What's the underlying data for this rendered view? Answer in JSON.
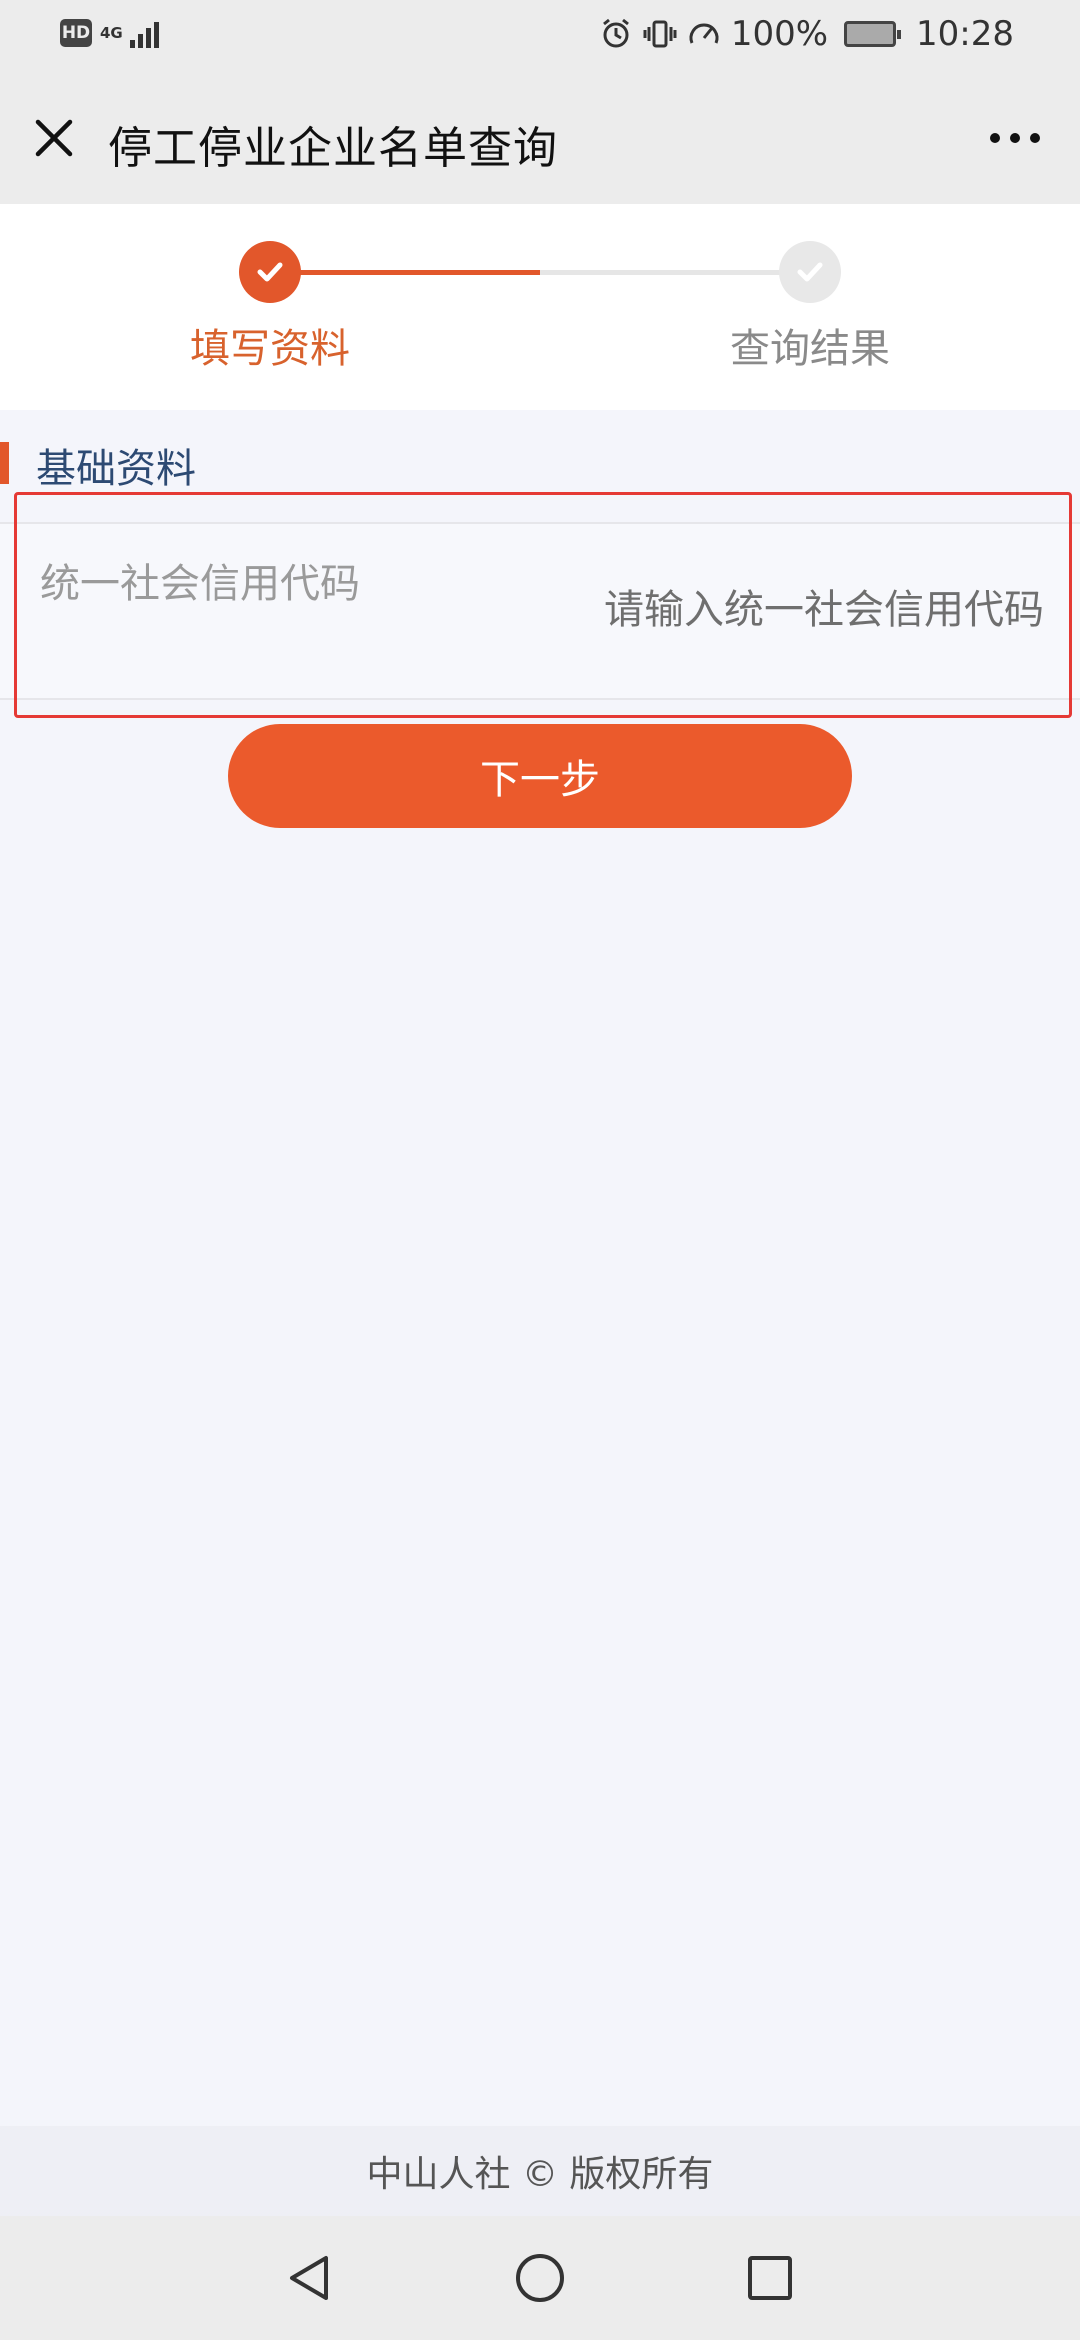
{
  "status_bar": {
    "hd_badge": "HD",
    "network_label": "4G",
    "battery_percent": "100%",
    "time": "10:28",
    "icons": [
      "alarm-icon",
      "vibrate-icon",
      "speed-icon",
      "battery-icon"
    ]
  },
  "header": {
    "title": "停工停业企业名单查询",
    "close_icon": "close-icon",
    "more_icon": "more-icon"
  },
  "steps": {
    "items": [
      {
        "label": "填写资料",
        "state": "active"
      },
      {
        "label": "查询结果",
        "state": "inactive"
      }
    ]
  },
  "section": {
    "title": "基础资料"
  },
  "form": {
    "credit_code": {
      "label": "统一社会信用代码",
      "placeholder": "请输入统一社会信用代码",
      "value": ""
    }
  },
  "actions": {
    "next_label": "下一步"
  },
  "footer": {
    "text": "中山人社 © 版权所有"
  },
  "colors": {
    "accent": "#eb5a2c",
    "section_title": "#2d4a73",
    "highlight_border": "#e53935"
  }
}
